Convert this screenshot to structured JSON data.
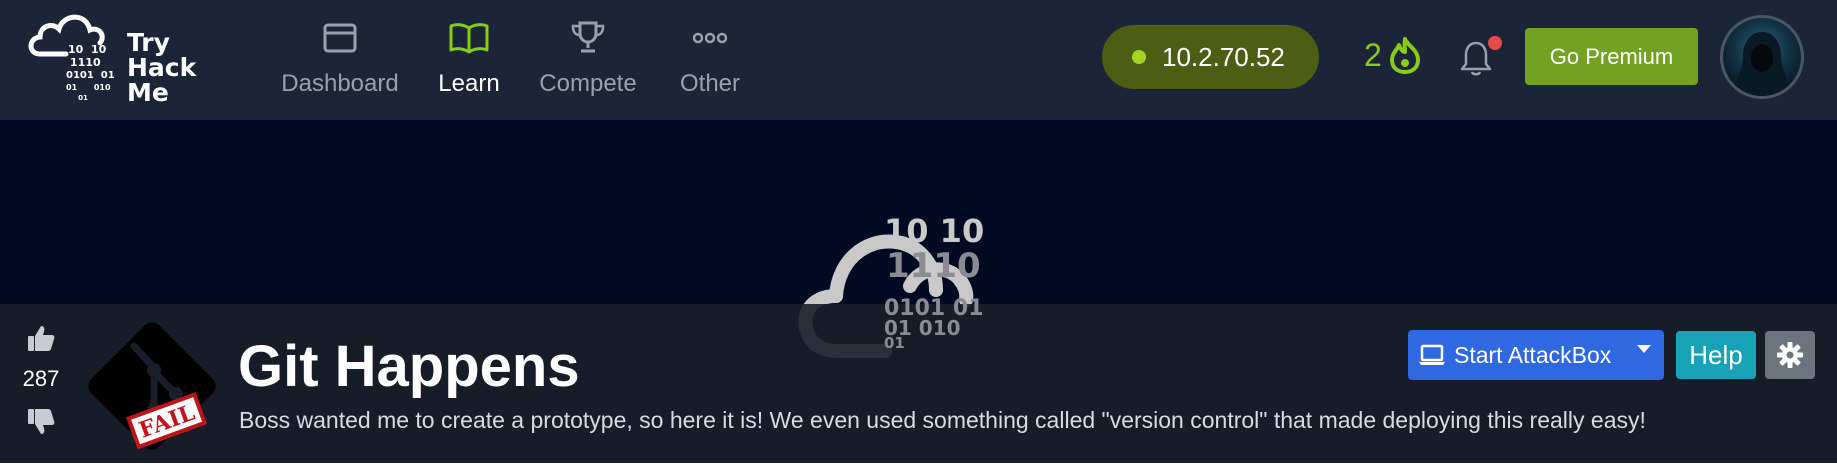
{
  "brand": {
    "lines": [
      "Try",
      "Hack",
      "Me"
    ],
    "binary": [
      "10  10",
      "1110",
      "0101  01",
      "01      010",
      "     01"
    ]
  },
  "nav": {
    "items": [
      {
        "label": "Dashboard",
        "icon": "browser-window-icon",
        "active": false
      },
      {
        "label": "Learn",
        "icon": "open-book-icon",
        "active": true
      },
      {
        "label": "Compete",
        "icon": "trophy-icon",
        "active": false
      },
      {
        "label": "Other",
        "icon": "ellipsis-icon",
        "active": false
      }
    ]
  },
  "status": {
    "ip_address": "10.2.70.52",
    "streak_count": "2",
    "notification_badge": true
  },
  "premium": {
    "label": "Go Premium"
  },
  "hero": {
    "binary": [
      "10  10",
      "1110",
      "0101   01",
      "01        010",
      "      01"
    ]
  },
  "room": {
    "title": "Git Happens",
    "description": "Boss wanted me to create a prototype, so here it is! We even used something called \"version control\" that made deploying this really easy!",
    "votes": "287",
    "badge_text": "FAIL"
  },
  "actions": {
    "attackbox_label": "Start AttackBox",
    "help_label": "Help"
  },
  "colors": {
    "nav_bg": "#1c2538",
    "hero_bg": "#020a23",
    "accent_green": "#88cc14",
    "premium_green": "#73a222",
    "attack_blue": "#2f68e0",
    "help_teal": "#17a2b8",
    "fail_red": "#c0141b"
  }
}
